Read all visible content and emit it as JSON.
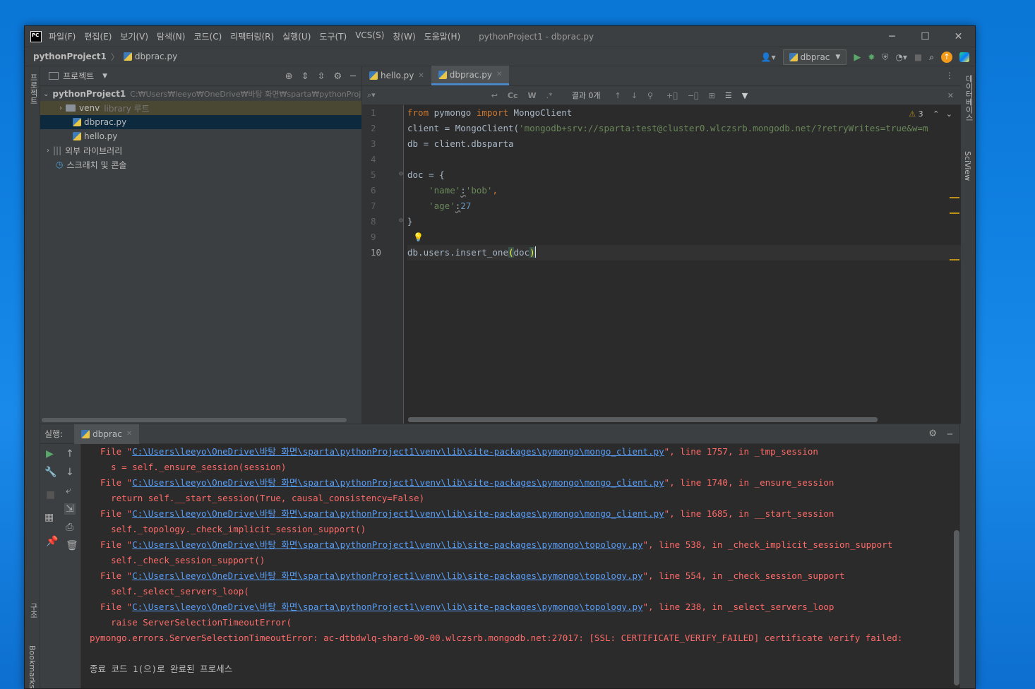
{
  "window": {
    "title": "pythonProject1 - dbprac.py",
    "logo": "PC",
    "menu": [
      "파일(F)",
      "편집(E)",
      "보기(V)",
      "탐색(N)",
      "코드(C)",
      "리팩터링(R)",
      "실행(U)",
      "도구(T)",
      "VCS(S)",
      "창(W)",
      "도움말(H)"
    ]
  },
  "navbar": {
    "project": "pythonProject1",
    "file": "dbprac.py",
    "run_config": "dbprac"
  },
  "left_strip": {
    "project": "프로젝트",
    "structure": "구조",
    "bookmarks": "Bookmarks"
  },
  "right_strip": {
    "database": "데이터베이스",
    "sciview": "SciView"
  },
  "project_panel": {
    "title": "프로젝트",
    "root": {
      "name": "pythonProject1",
      "path": "C:₩Users₩leeyo₩OneDrive₩바탕 화면₩sparta₩pythonProje"
    },
    "venv": {
      "name": "venv",
      "hint": "library 루트"
    },
    "files": [
      "dbprac.py",
      "hello.py"
    ],
    "external": "외부 라이브러리",
    "scratch": "스크래치 및 콘솔"
  },
  "editor": {
    "tabs": [
      "hello.py",
      "dbprac.py"
    ],
    "active_tab": "dbprac.py",
    "find_results": "결과 0개",
    "warnings": "3",
    "find_buttons": {
      "case": "Cc",
      "word": "W",
      "regex": ".*"
    },
    "line_numbers": [
      "1",
      "2",
      "3",
      "4",
      "5",
      "6",
      "7",
      "8",
      "9",
      "10"
    ],
    "code": {
      "l1": {
        "kw1": "from",
        "mod": " pymongo ",
        "kw2": "import",
        "cls": " MongoClient"
      },
      "l2": {
        "pre": "client = MongoClient(",
        "str": "'mongodb+srv://sparta:test@cluster0.wlczsrb.mongodb.net/?retryWrites=true&w=m"
      },
      "l3": "db = client.dbsparta",
      "l5": "doc = {",
      "l6": {
        "indent": "    ",
        "key": "'name'",
        "sep": ":",
        "val": "'bob'",
        "end": ","
      },
      "l7": {
        "indent": "    ",
        "key": "'age'",
        "sep": ":",
        "val": "27"
      },
      "l8": "}",
      "l10": {
        "pre": "db.users.insert_one",
        "open": "(",
        "arg": "doc",
        "close": ")"
      }
    }
  },
  "run_panel": {
    "label": "실행:",
    "tab": "dbprac",
    "lines": [
      {
        "pre": "  File \"",
        "link": "C:\\Users\\leeyo\\OneDrive\\바탕 화면\\sparta\\pythonProject1\\venv\\lib\\site-packages\\pymongo\\mongo_client.py",
        "post": "\", line 1757, in _tmp_session"
      },
      {
        "text": "    s = self._ensure_session(session)"
      },
      {
        "pre": "  File \"",
        "link": "C:\\Users\\leeyo\\OneDrive\\바탕 화면\\sparta\\pythonProject1\\venv\\lib\\site-packages\\pymongo\\mongo_client.py",
        "post": "\", line 1740, in _ensure_session"
      },
      {
        "text": "    return self.__start_session(True, causal_consistency=False)"
      },
      {
        "pre": "  File \"",
        "link": "C:\\Users\\leeyo\\OneDrive\\바탕 화면\\sparta\\pythonProject1\\venv\\lib\\site-packages\\pymongo\\mongo_client.py",
        "post": "\", line 1685, in __start_session"
      },
      {
        "text": "    self._topology._check_implicit_session_support()"
      },
      {
        "pre": "  File \"",
        "link": "C:\\Users\\leeyo\\OneDrive\\바탕 화면\\sparta\\pythonProject1\\venv\\lib\\site-packages\\pymongo\\topology.py",
        "post": "\", line 538, in _check_implicit_session_support"
      },
      {
        "text": "    self._check_session_support()"
      },
      {
        "pre": "  File \"",
        "link": "C:\\Users\\leeyo\\OneDrive\\바탕 화면\\sparta\\pythonProject1\\venv\\lib\\site-packages\\pymongo\\topology.py",
        "post": "\", line 554, in _check_session_support"
      },
      {
        "text": "    self._select_servers_loop("
      },
      {
        "pre": "  File \"",
        "link": "C:\\Users\\leeyo\\OneDrive\\바탕 화면\\sparta\\pythonProject1\\venv\\lib\\site-packages\\pymongo\\topology.py",
        "post": "\", line 238, in _select_servers_loop"
      },
      {
        "text": "    raise ServerSelectionTimeoutError("
      },
      {
        "text": "pymongo.errors.ServerSelectionTimeoutError: ac-dtbdwlq-shard-00-00.wlczsrb.mongodb.net:27017: [SSL: CERTIFICATE_VERIFY_FAILED] certificate verify failed:"
      },
      {
        "text": ""
      },
      {
        "text": "종료 코드 1(으)로 완료된 프로세스",
        "normal": true
      }
    ]
  }
}
